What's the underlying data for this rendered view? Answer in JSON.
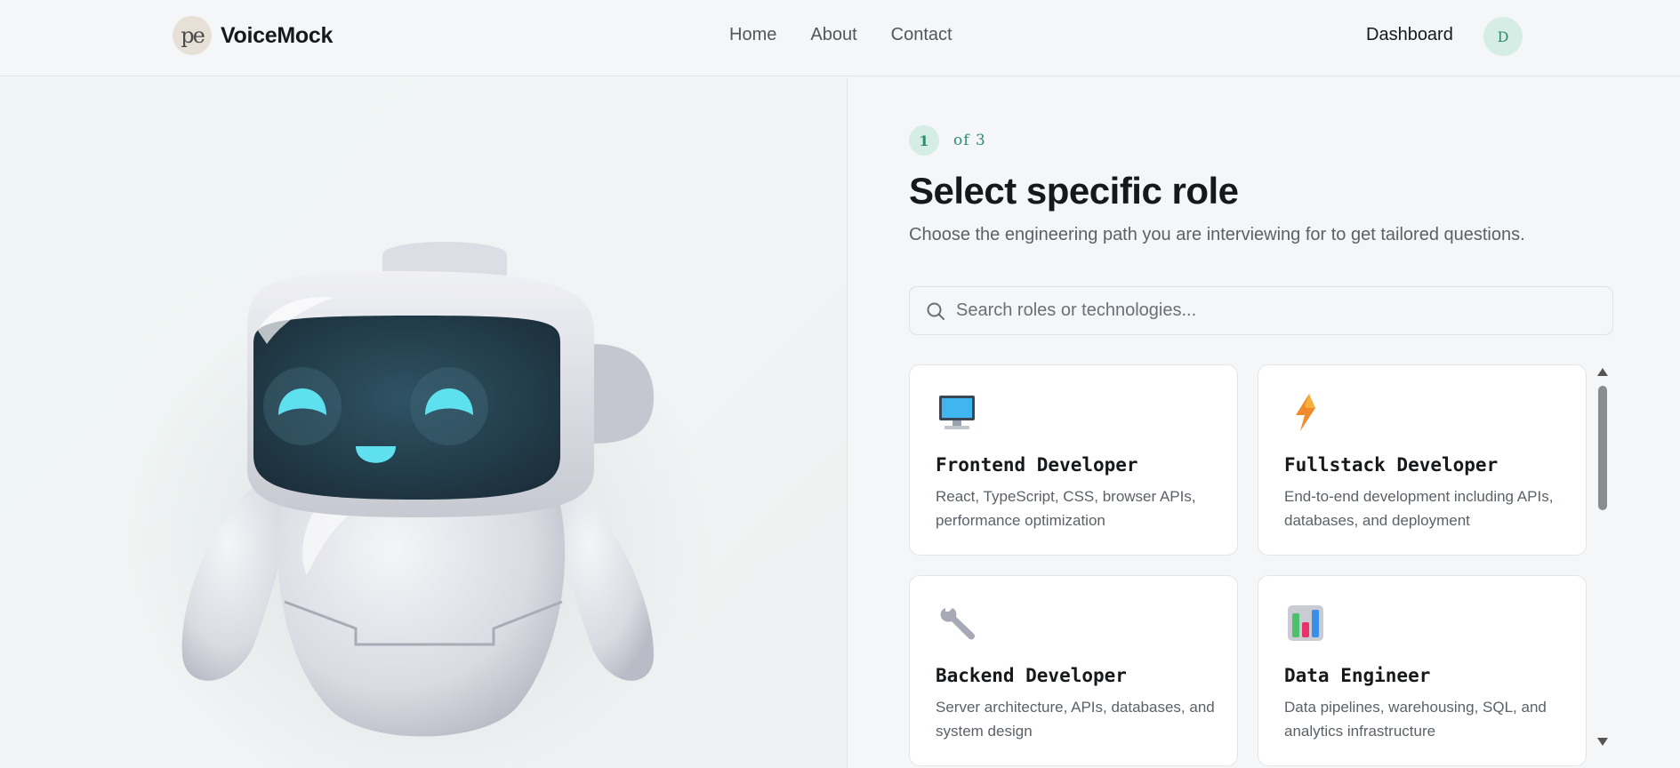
{
  "app": {
    "name": "VoiceMock",
    "logo_glyph": "pe"
  },
  "nav": {
    "items": [
      {
        "label": "Home"
      },
      {
        "label": "About"
      },
      {
        "label": "Contact"
      }
    ]
  },
  "header": {
    "dashboard_label": "Dashboard",
    "avatar_initial": "D"
  },
  "step": {
    "current": "1",
    "of_label": "of 3"
  },
  "page": {
    "title": "Select specific role",
    "subtitle": "Choose the engineering path you are interviewing for to get tailored questions."
  },
  "search": {
    "placeholder": "Search roles or technologies..."
  },
  "roles": [
    {
      "title": "Frontend Developer",
      "description": "React, TypeScript, CSS, browser APIs, performance optimization",
      "icon": "desktop-computer-icon"
    },
    {
      "title": "Fullstack Developer",
      "description": "End-to-end development including APIs, databases, and deployment",
      "icon": "lightning-icon"
    },
    {
      "title": "Backend Developer",
      "description": "Server architecture, APIs, databases, and system design",
      "icon": "wrench-icon"
    },
    {
      "title": "Data Engineer",
      "description": "Data pipelines, warehousing, SQL, and analytics infrastructure",
      "icon": "bar-chart-icon"
    }
  ],
  "colors": {
    "accent": "#2d8b72",
    "accent_bg": "#d6ede6",
    "background": "#f5f6f7",
    "card": "#ffffff"
  }
}
